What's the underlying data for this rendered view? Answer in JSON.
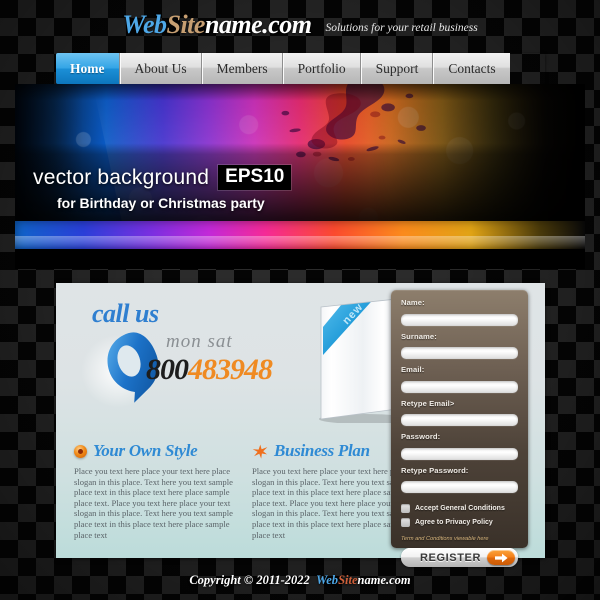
{
  "header": {
    "logo": {
      "part1": "Web",
      "part2": "Site",
      "part3": "name.com"
    },
    "tagline": "Solutions for your retail business"
  },
  "nav": {
    "items": [
      {
        "label": "Home",
        "active": true
      },
      {
        "label": "About Us",
        "active": false
      },
      {
        "label": "Members",
        "active": false
      },
      {
        "label": "Portfolio",
        "active": false
      },
      {
        "label": "Support",
        "active": false
      },
      {
        "label": "Contacts",
        "active": false
      }
    ]
  },
  "banner": {
    "headline": "vector background",
    "badge": "EPS10",
    "subline": "for Birthday or Christmas party"
  },
  "callus": {
    "title": "call us",
    "hours": "mon sat",
    "number_prefix": "800",
    "number_suffix": "483948",
    "icon": "phone-icon"
  },
  "product_box": {
    "ribbon_label": "new"
  },
  "columns": [
    {
      "icon": "target-circle-icon",
      "title": "Your Own Style",
      "body": "Place you text here place your text here place slogan in this place. Text here you text sample place text in this place text here place sample place text. Place you text here place your text slogan in this place. Text here you text sample place text in this place text here place sample place text"
    },
    {
      "icon": "star-icon",
      "title": "Business Plan",
      "body": "Place you text here place your text here place slogan in this place. Text here you text sample place text in this place text here place sample place text. Place you text here place your text slogan in this place. Text here you text sample place text in this place text here place sample place text"
    }
  ],
  "form": {
    "fields": [
      {
        "label": "Name:",
        "value": "",
        "placeholder": ""
      },
      {
        "label": "Surname:",
        "value": "",
        "placeholder": ""
      },
      {
        "label": "Email:",
        "value": "",
        "placeholder": ""
      },
      {
        "label": "Retype Email>",
        "value": "",
        "placeholder": ""
      },
      {
        "label": "Password:",
        "value": "",
        "placeholder": ""
      },
      {
        "label": "Retype Password:",
        "value": "",
        "placeholder": ""
      }
    ],
    "checkboxes": [
      {
        "label": "Accept General Conditions",
        "checked": false
      },
      {
        "label": "Agree to Privacy Policy",
        "checked": false
      }
    ],
    "terms_note": "Term and Conditions viewable here",
    "submit_label": "REGISTER",
    "submit_icon": "arrow-right-icon"
  },
  "footer": {
    "copyright": "Copyright © 2011-2022",
    "logo": {
      "part1": "Web",
      "part2": "Site",
      "part3": "name.com"
    }
  },
  "colors": {
    "accent_blue": "#2f8ad4",
    "nav_active": "#1b8fd6",
    "accent_orange": "#ef8a22",
    "form_panel": "#6e6053",
    "content_bg": "#dfe4e6",
    "page_bg": "#151515"
  }
}
